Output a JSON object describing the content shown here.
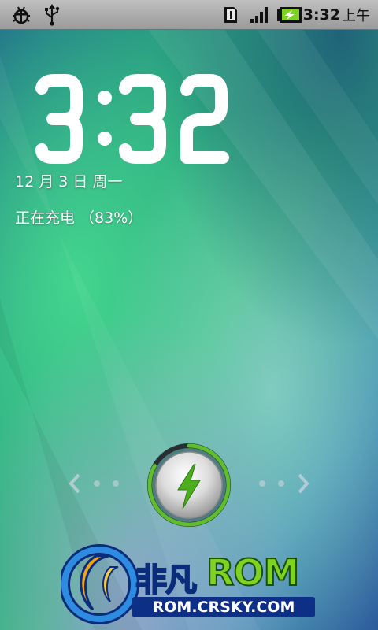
{
  "status_bar": {
    "left_icons": [
      "usb-debugging-icon",
      "usb-icon"
    ],
    "right_icons": [
      "sd-card-icon",
      "signal-icon",
      "battery-charging-icon"
    ],
    "time": "3:32",
    "ampm": "上午"
  },
  "lockscreen": {
    "clock": "3:32",
    "date": "12 月 3 日 周一",
    "charging": "正在充电 （83%）",
    "unlock_icon": "lightning-icon",
    "battery_percent": 83
  },
  "watermark": {
    "brand_cn": "非凡",
    "brand_rom": "ROM",
    "url": "ROM.CRSKY.COM"
  },
  "colors": {
    "accent_green": "#7ed321",
    "ring_green": "#5fbf2a",
    "statusbar": "#a9aaa9"
  }
}
